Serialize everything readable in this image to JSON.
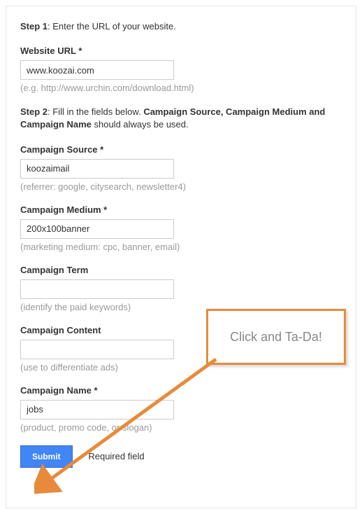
{
  "step1": {
    "bold": "Step 1",
    "text": ": Enter the URL of your website."
  },
  "step2": {
    "bold1": "Step 2",
    "text1": ": Fill in the fields below. ",
    "bold2": "Campaign Source, Campaign Medium and Campaign Name",
    "text2": " should always be used."
  },
  "fields": {
    "url": {
      "label": "Website URL *",
      "value": "www.koozai.com",
      "hint": "(e.g. http://www.urchin.com/download.html)"
    },
    "source": {
      "label": "Campaign Source *",
      "value": "koozaimail",
      "hint": "(referrer: google, citysearch, newsletter4)"
    },
    "medium": {
      "label": "Campaign Medium *",
      "value": "200x100banner",
      "hint": "(marketing medium: cpc, banner, email)"
    },
    "term": {
      "label": "Campaign Term",
      "value": "",
      "hint": "(identify the paid keywords)"
    },
    "content": {
      "label": "Campaign Content",
      "value": "",
      "hint": "(use to differentiate ads)"
    },
    "name": {
      "label": "Campaign Name *",
      "value": "jobs",
      "hint": "(product, promo code, or slogan)"
    }
  },
  "submit": {
    "button": "Submit",
    "required": "* Required field"
  },
  "callout": {
    "text": "Click and Ta-Da!"
  }
}
